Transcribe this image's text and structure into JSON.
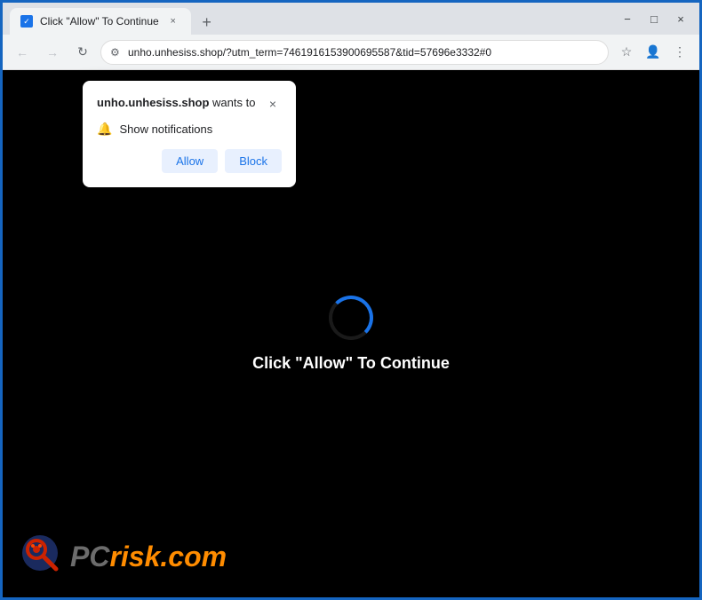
{
  "browser": {
    "title_bar": {
      "tab_title": "Click \"Allow\" To Continue",
      "new_tab_label": "+",
      "minimize_label": "−",
      "maximize_label": "□",
      "close_label": "×"
    },
    "nav_bar": {
      "back_label": "←",
      "forward_label": "→",
      "reload_label": "↻",
      "url": "unho.unhesiss.shop/?utm_term=7461916153900695587&tid=57696e3332#0",
      "bookmark_label": "☆",
      "profile_label": "👤",
      "menu_label": "⋮"
    }
  },
  "notification_popup": {
    "site_name": "unho.unhesiss.shop",
    "wants_to_text": " wants to",
    "close_label": "×",
    "notification_label": "Show notifications",
    "allow_label": "Allow",
    "block_label": "Block"
  },
  "page": {
    "loading_message": "Click \"Allow\" To Continue",
    "spinner_visible": true
  },
  "watermark": {
    "pc_text": "PC",
    "risk_text": "risk",
    "dot_com": ".com"
  }
}
